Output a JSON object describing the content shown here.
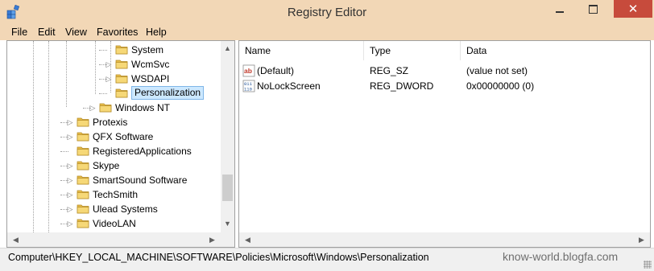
{
  "window": {
    "title": "Registry Editor",
    "close_glyph": "✕"
  },
  "menu": [
    "File",
    "Edit",
    "View",
    "Favorites",
    "Help"
  ],
  "tree": [
    {
      "label": "System",
      "expander": ""
    },
    {
      "label": "WcmSvc",
      "expander": "▷"
    },
    {
      "label": "WSDAPI",
      "expander": "▷"
    },
    {
      "label": "Personalization",
      "expander": "",
      "selected": true
    },
    {
      "label": "Windows NT",
      "expander": "▷"
    },
    {
      "label": "Protexis",
      "expander": "▷"
    },
    {
      "label": "QFX Software",
      "expander": "▷"
    },
    {
      "label": "RegisteredApplications",
      "expander": ""
    },
    {
      "label": "Skype",
      "expander": "▷"
    },
    {
      "label": "SmartSound Software",
      "expander": "▷"
    },
    {
      "label": "TechSmith",
      "expander": "▷"
    },
    {
      "label": "Ulead Systems",
      "expander": "▷"
    },
    {
      "label": "VideoLAN",
      "expander": "▷"
    }
  ],
  "columns": {
    "name": "Name",
    "type": "Type",
    "data": "Data"
  },
  "values": [
    {
      "icon": "string-value-icon",
      "icon_text": "ab",
      "name": "(Default)",
      "type": "REG_SZ",
      "data": "(value not set)"
    },
    {
      "icon": "dword-value-icon",
      "icon_text": "011\n110",
      "name": "NoLockScreen",
      "type": "REG_DWORD",
      "data": "0x00000000 (0)"
    }
  ],
  "status": {
    "path": "Computer\\HKEY_LOCAL_MACHINE\\SOFTWARE\\Policies\\Microsoft\\Windows\\Personalization",
    "watermark": "know-world.blogfa.com"
  },
  "colors": {
    "titlebar": "#f2d7b6",
    "close_button": "#c74b3c",
    "selection": "#cce8ff",
    "folder": "#e8bd4a"
  },
  "scroll_arrows": {
    "up": "▲",
    "down": "▼",
    "left": "◀",
    "right": "▶"
  }
}
